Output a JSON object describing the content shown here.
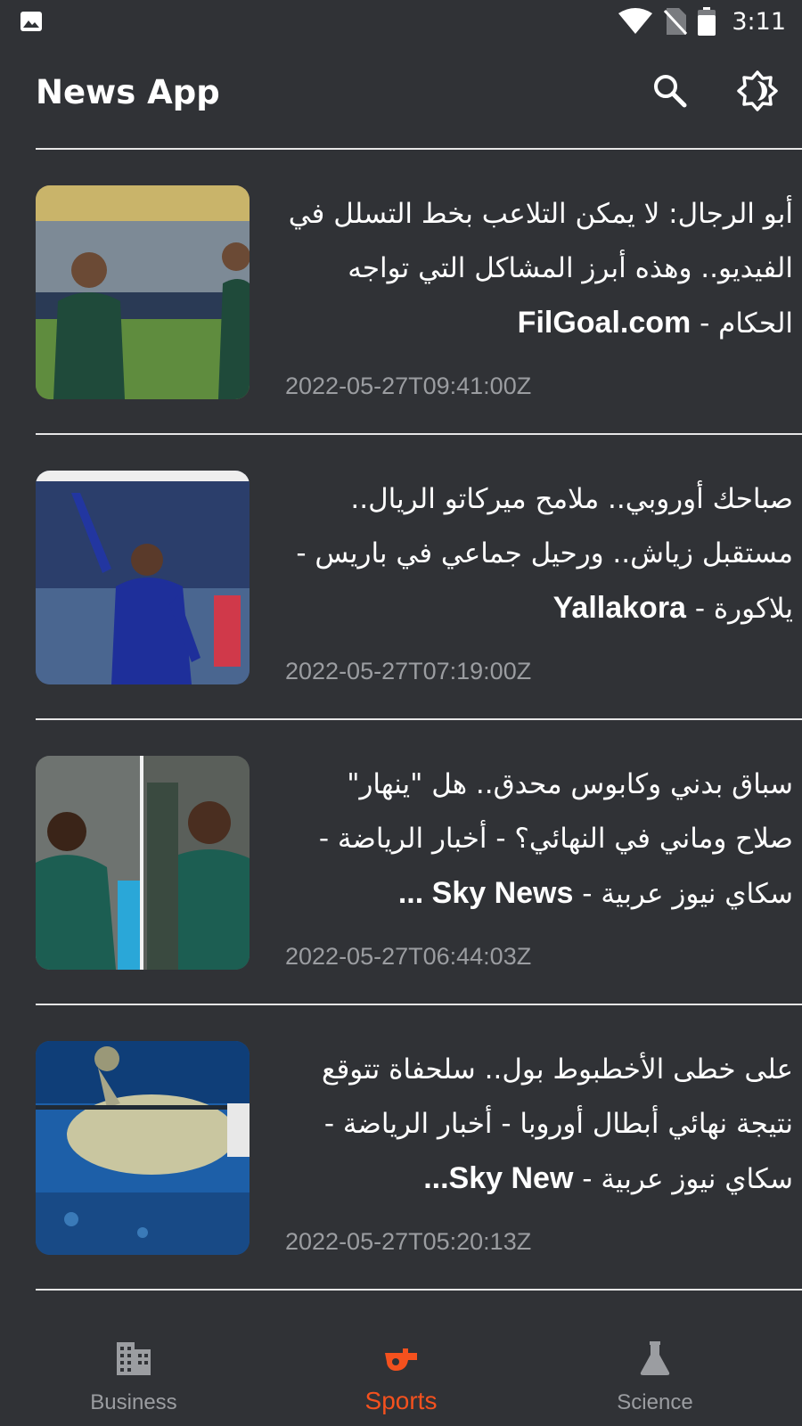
{
  "status_bar": {
    "time": "3:11"
  },
  "app_bar": {
    "title": "News App"
  },
  "icons": {
    "search": "search-icon",
    "theme": "brightness-icon",
    "business": "business-icon",
    "sports": "whistle-icon",
    "science": "flask-icon"
  },
  "news": [
    {
      "title": "أبو الرجال: لا يمكن التلاعب بخط التسلل في الفيديو.. وهذه أبرز المشاكل التي تواجه الحكام",
      "source": "FilGoal.com",
      "date": "2022-05-27T09:41:00Z"
    },
    {
      "title": "صباحك أوروبي.. ملامح ميركاتو الريال.. مستقبل زياش.. ورحيل جماعي في باريس - يلاكورة",
      "source": "Yallakora",
      "date": "2022-05-27T07:19:00Z"
    },
    {
      "title": "سباق بدني وكابوس محدق.. هل \"ينهار\" صلاح وماني في النهائي؟ - أخبار الرياضة - سكاي نيوز عربية",
      "source": "Sky News ...",
      "date": "2022-05-27T06:44:03Z"
    },
    {
      "title": "على خطى الأخطبوط بول.. سلحفاة تتوقع نتيجة نهائي أبطال أوروبا - أخبار الرياضة - سكاي نيوز عربية",
      "source": "Sky New...",
      "date": "2022-05-27T05:20:13Z"
    }
  ],
  "bottom_nav": [
    {
      "label": "Business",
      "active": false
    },
    {
      "label": "Sports",
      "active": true
    },
    {
      "label": "Science",
      "active": false
    }
  ],
  "colors": {
    "background": "#303236",
    "accent": "#f4511e",
    "inactive": "#9b9da1",
    "divider": "#e6e6e6"
  }
}
